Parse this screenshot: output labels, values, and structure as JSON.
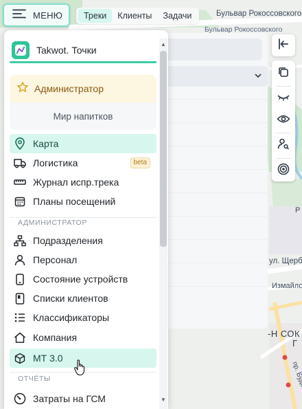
{
  "top_bar": {
    "menu_label": "МЕНЮ",
    "tabs": [
      "Треки",
      "Клиенты",
      "Задачи"
    ],
    "active_tab": 0
  },
  "map_labels": {
    "street_top": "Бульвар Рокоссовского",
    "street_top2": "Бульвар Рокоссовского",
    "ul_sherb": "ул. Щерб",
    "izmaylov": "Измайловс",
    "sok": "-Н СОК",
    "go": "Г",
    "pr_bud": "пр. Буден",
    "rk": "Р"
  },
  "dropdown": {
    "brand_name": "Takwot. Точки",
    "role": "Администратор",
    "organization": "Мир напитков",
    "items_main": [
      {
        "label": "Карта",
        "icon": "map-pin-icon",
        "active": true
      },
      {
        "label": "Логистика",
        "icon": "truck-icon",
        "badge": "beta"
      },
      {
        "label": "Журнал испр.трека",
        "icon": "ruler-icon"
      },
      {
        "label": "Планы посещений",
        "icon": "calendar-icon"
      }
    ],
    "section_admin": "АДМИНИСТРАТОР",
    "items_admin": [
      {
        "label": "Подразделения",
        "icon": "org-chart-icon"
      },
      {
        "label": "Персонал",
        "icon": "user-icon"
      },
      {
        "label": "Состояние устройств",
        "icon": "device-icon"
      },
      {
        "label": "Списки клиентов",
        "icon": "client-list-icon"
      },
      {
        "label": "Классификаторы",
        "icon": "list-icon"
      },
      {
        "label": "Компания",
        "icon": "home-icon"
      },
      {
        "label": "МТ 3.0",
        "icon": "cube-icon",
        "hover": true
      }
    ],
    "section_reports": "ОТЧЁТЫ",
    "items_reports": [
      {
        "label": "Затраты на ГСМ",
        "icon": "gauge-icon"
      }
    ]
  },
  "toolbar_icons": [
    "collapse-panel-icon",
    "copy-icon",
    "eye-closed-icon",
    "eye-icon",
    "user-search-icon",
    "target-icon"
  ],
  "colors": {
    "accent": "#3ecba3",
    "active_bg": "#d6f6ee",
    "role_bg": "#fdf6e0",
    "role_text": "#8a5a12"
  }
}
